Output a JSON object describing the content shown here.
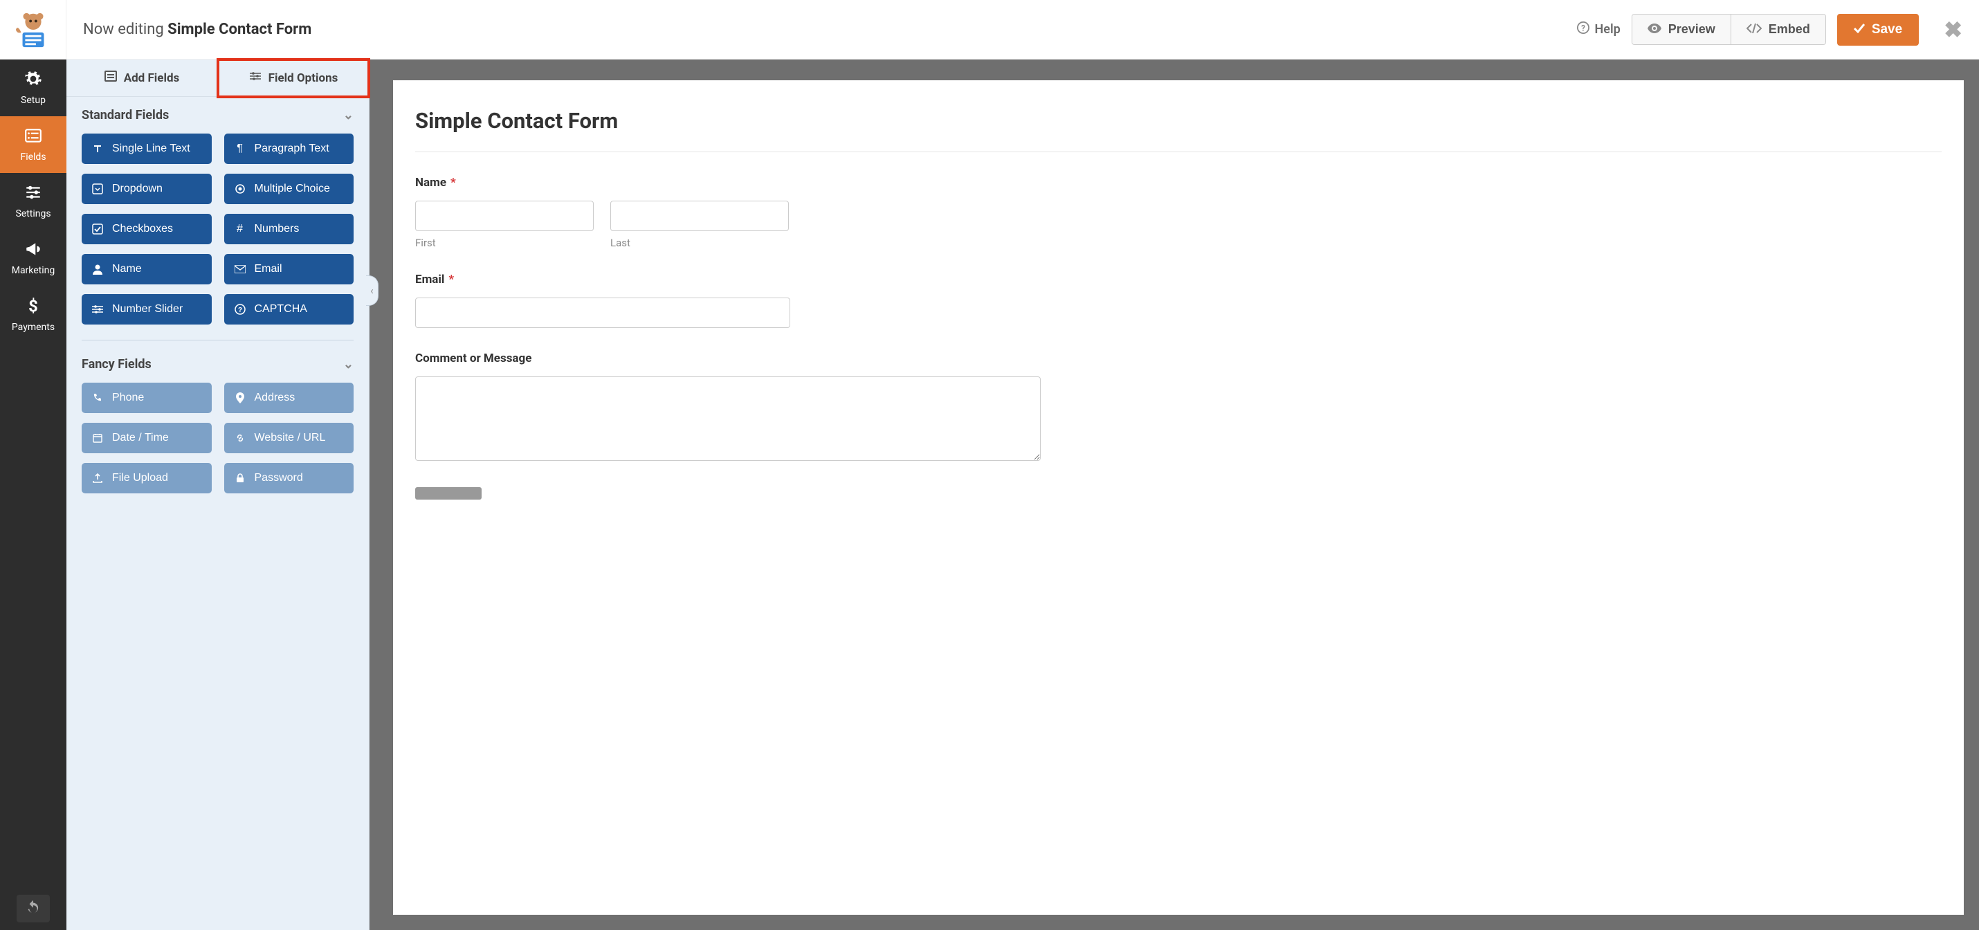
{
  "header": {
    "editing_prefix": "Now editing",
    "form_name": "Simple Contact Form",
    "help": "Help",
    "preview": "Preview",
    "embed": "Embed",
    "save": "Save"
  },
  "rail": {
    "setup": "Setup",
    "fields": "Fields",
    "settings": "Settings",
    "marketing": "Marketing",
    "payments": "Payments"
  },
  "panel": {
    "tab_add": "Add Fields",
    "tab_options": "Field Options",
    "group_standard": "Standard Fields",
    "group_fancy": "Fancy Fields",
    "standard": {
      "single_line": "Single Line Text",
      "paragraph": "Paragraph Text",
      "dropdown": "Dropdown",
      "multiple_choice": "Multiple Choice",
      "checkboxes": "Checkboxes",
      "numbers": "Numbers",
      "name": "Name",
      "email": "Email",
      "number_slider": "Number Slider",
      "captcha": "CAPTCHA"
    },
    "fancy": {
      "phone": "Phone",
      "address": "Address",
      "datetime": "Date / Time",
      "website": "Website / URL",
      "file_upload": "File Upload",
      "password": "Password"
    }
  },
  "canvas": {
    "title": "Simple Contact Form",
    "name_label": "Name",
    "first": "First",
    "last": "Last",
    "email_label": "Email",
    "comment_label": "Comment or Message",
    "required_mark": "*"
  }
}
